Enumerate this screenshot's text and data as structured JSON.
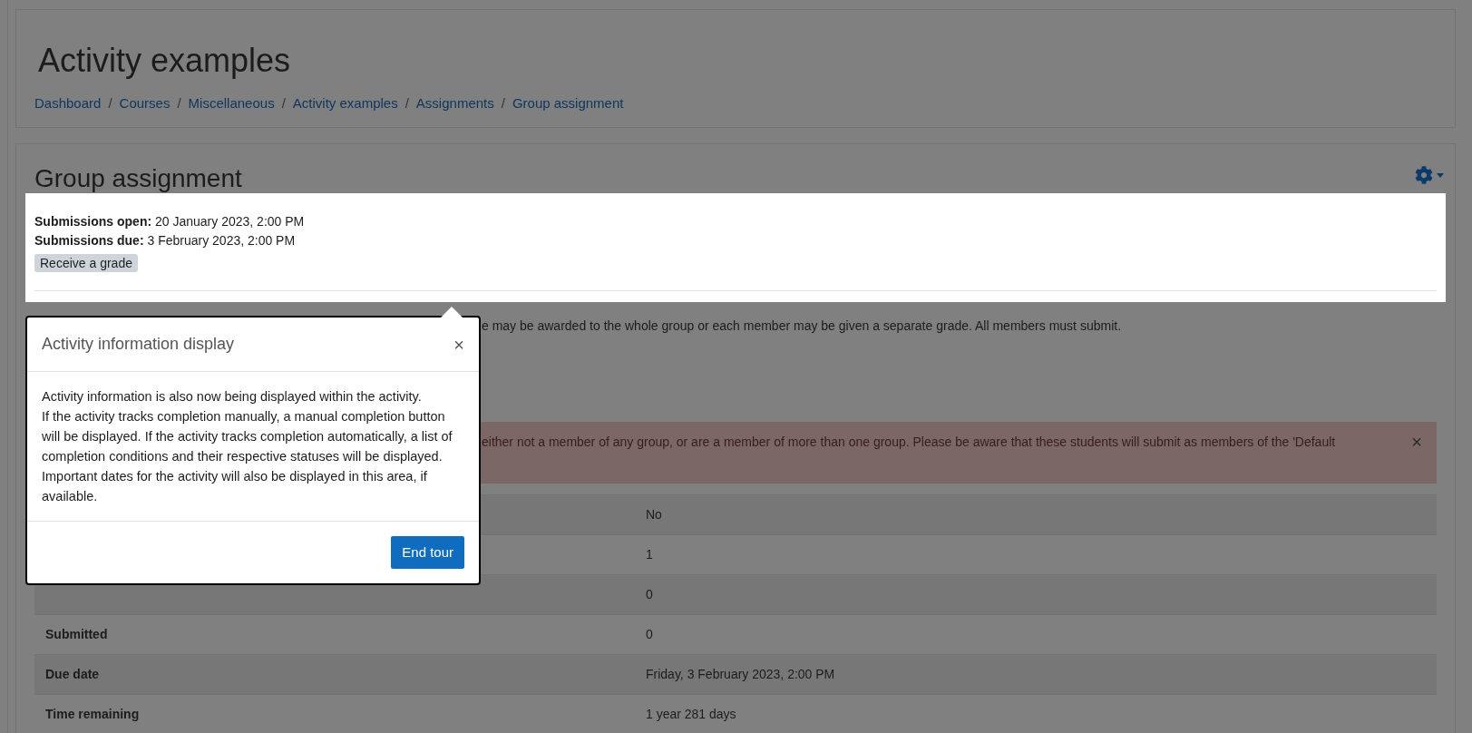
{
  "page_header": {
    "title": "Activity examples",
    "separator": "/",
    "breadcrumb": [
      "Dashboard",
      "Courses",
      "Miscellaneous",
      "Activity examples",
      "Assignments",
      "Group assignment"
    ]
  },
  "activity": {
    "title": "Group assignment",
    "dates": [
      {
        "label": "Submissions open:",
        "value": "20 January 2023, 2:00 PM"
      },
      {
        "label": "Submissions due:",
        "value": "3 February 2023, 2:00 PM"
      }
    ],
    "completion_badge": "Receive a grade",
    "description": "e may be awarded to the whole group or each member may be given a separate grade. All members must submit.",
    "alert": {
      "text": "either not a member of any group, or are a member of more than one group. Please be aware that these students will submit as members of the 'Default",
      "close": "×"
    },
    "table": {
      "rows": [
        {
          "value": "No"
        },
        {
          "value": "1"
        },
        {
          "value": "0"
        },
        {
          "label": "Submitted",
          "value": "0"
        },
        {
          "label": "Due date",
          "value": "Friday, 3 February 2023, 2:00 PM"
        },
        {
          "label": "Time remaining",
          "value": "1 year 281 days"
        }
      ]
    }
  },
  "tour": {
    "title": "Activity information display",
    "close": "×",
    "body": [
      "Activity information is also now being displayed within the activity.",
      "If the activity tracks completion manually, a manual completion button will be displayed. If the activity tracks completion automatically, a list of completion conditions and their respective statuses will be displayed.",
      "Important dates for the activity will also be displayed in this area, if available."
    ],
    "button": "End tour"
  }
}
